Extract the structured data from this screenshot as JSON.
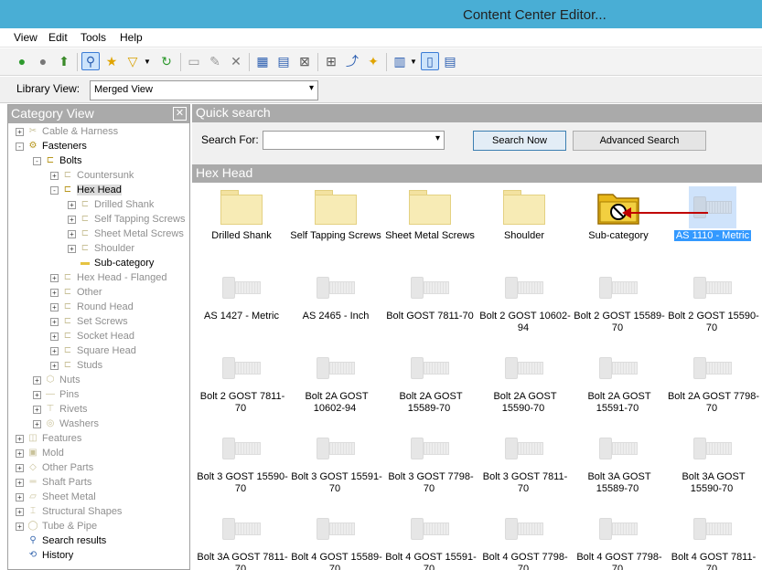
{
  "window": {
    "title": "Content Center Editor..."
  },
  "menu": [
    "View",
    "Edit",
    "Tools",
    "Help"
  ],
  "toolbar": {
    "icons": [
      "back-icon",
      "forward-icon",
      "up-folder-icon",
      "search-icon",
      "favorite-star-icon",
      "filter-icon",
      "filter-dropdown-icon",
      "refresh-icon",
      "new-folder-icon",
      "edit-folder-icon",
      "delete-folder-icon",
      "table-edit-icon",
      "family-properties-icon",
      "family-delete-icon",
      "hierarchy-icon",
      "publish-icon",
      "magic-icon",
      "view-options-icon",
      "view-dropdown-icon",
      "split-view-icon",
      "details-view-icon"
    ]
  },
  "library": {
    "label": "Library View:",
    "value": "Merged View"
  },
  "category": {
    "title": "Category View",
    "tree": [
      {
        "label": "Cable & Harness",
        "level": 0,
        "expander": "+",
        "dim": true,
        "icon": "cable-icon"
      },
      {
        "label": "Fasteners",
        "level": 0,
        "expander": "-",
        "dim": false,
        "icon": "fastener-icon"
      },
      {
        "label": "Bolts",
        "level": 1,
        "expander": "-",
        "dim": false,
        "icon": "bolt-icon"
      },
      {
        "label": "Countersunk",
        "level": 2,
        "expander": "+",
        "dim": true,
        "icon": "bolt-icon"
      },
      {
        "label": "Hex Head",
        "level": 2,
        "expander": "-",
        "dim": false,
        "icon": "bolt-icon",
        "selected": true
      },
      {
        "label": "Drilled Shank",
        "level": 3,
        "expander": "+",
        "dim": true,
        "icon": "bolt-icon"
      },
      {
        "label": "Self Tapping Screws",
        "level": 3,
        "expander": "+",
        "dim": true,
        "icon": "bolt-icon"
      },
      {
        "label": "Sheet Metal Screws",
        "level": 3,
        "expander": "+",
        "dim": true,
        "icon": "bolt-icon"
      },
      {
        "label": "Shoulder",
        "level": 3,
        "expander": "+",
        "dim": true,
        "icon": "bolt-icon"
      },
      {
        "label": "Sub-category",
        "level": 3,
        "expander": "",
        "dim": false,
        "icon": "folder-icon"
      },
      {
        "label": "Hex Head - Flanged",
        "level": 2,
        "expander": "+",
        "dim": true,
        "icon": "bolt-icon"
      },
      {
        "label": "Other",
        "level": 2,
        "expander": "+",
        "dim": true,
        "icon": "bolt-icon"
      },
      {
        "label": "Round Head",
        "level": 2,
        "expander": "+",
        "dim": true,
        "icon": "bolt-icon"
      },
      {
        "label": "Set Screws",
        "level": 2,
        "expander": "+",
        "dim": true,
        "icon": "bolt-icon"
      },
      {
        "label": "Socket Head",
        "level": 2,
        "expander": "+",
        "dim": true,
        "icon": "bolt-icon"
      },
      {
        "label": "Square Head",
        "level": 2,
        "expander": "+",
        "dim": true,
        "icon": "bolt-icon"
      },
      {
        "label": "Studs",
        "level": 2,
        "expander": "+",
        "dim": true,
        "icon": "bolt-icon"
      },
      {
        "label": "Nuts",
        "level": 1,
        "expander": "+",
        "dim": true,
        "icon": "nut-icon"
      },
      {
        "label": "Pins",
        "level": 1,
        "expander": "+",
        "dim": true,
        "icon": "pin-icon"
      },
      {
        "label": "Rivets",
        "level": 1,
        "expander": "+",
        "dim": true,
        "icon": "rivet-icon"
      },
      {
        "label": "Washers",
        "level": 1,
        "expander": "+",
        "dim": true,
        "icon": "washer-icon"
      },
      {
        "label": "Features",
        "level": 0,
        "expander": "+",
        "dim": true,
        "icon": "feature-icon"
      },
      {
        "label": "Mold",
        "level": 0,
        "expander": "+",
        "dim": true,
        "icon": "mold-icon"
      },
      {
        "label": "Other Parts",
        "level": 0,
        "expander": "+",
        "dim": true,
        "icon": "part-icon"
      },
      {
        "label": "Shaft Parts",
        "level": 0,
        "expander": "+",
        "dim": true,
        "icon": "shaft-icon"
      },
      {
        "label": "Sheet Metal",
        "level": 0,
        "expander": "+",
        "dim": true,
        "icon": "sheet-metal-icon"
      },
      {
        "label": "Structural Shapes",
        "level": 0,
        "expander": "+",
        "dim": true,
        "icon": "structural-icon"
      },
      {
        "label": "Tube & Pipe",
        "level": 0,
        "expander": "+",
        "dim": true,
        "icon": "pipe-icon"
      },
      {
        "label": "Search results",
        "level": 0,
        "expander": "",
        "dim": false,
        "icon": "search-icon"
      },
      {
        "label": "History",
        "level": 0,
        "expander": "",
        "dim": false,
        "icon": "history-icon"
      }
    ]
  },
  "quick_search": {
    "title": "Quick search",
    "search_for_label": "Search For:",
    "search_value": "",
    "search_now": "Search Now",
    "advanced_search": "Advanced Search"
  },
  "hex_head": {
    "title": "Hex Head",
    "items": [
      {
        "label": "Drilled Shank",
        "kind": "folder"
      },
      {
        "label": "Self Tapping Screws",
        "kind": "folder"
      },
      {
        "label": "Sheet Metal Screws",
        "kind": "folder"
      },
      {
        "label": "Shoulder",
        "kind": "folder"
      },
      {
        "label": "Sub-category",
        "kind": "subcat"
      },
      {
        "label": "AS 1110 - Metric",
        "kind": "bolt",
        "selected": true
      },
      {
        "label": "AS 1427 - Metric",
        "kind": "bolt"
      },
      {
        "label": "AS 2465 - Inch",
        "kind": "bolt"
      },
      {
        "label": "Bolt  GOST 7811-70",
        "kind": "bolt"
      },
      {
        "label": "Bolt 2 GOST 10602-94",
        "kind": "bolt"
      },
      {
        "label": "Bolt 2 GOST 15589-70",
        "kind": "bolt"
      },
      {
        "label": "Bolt 2 GOST 15590-70",
        "kind": "bolt"
      },
      {
        "label": "Bolt 2 GOST 7811-70",
        "kind": "bolt"
      },
      {
        "label": "Bolt 2A GOST 10602-94",
        "kind": "bolt"
      },
      {
        "label": "Bolt 2A GOST 15589-70",
        "kind": "bolt"
      },
      {
        "label": "Bolt 2A GOST 15590-70",
        "kind": "bolt"
      },
      {
        "label": "Bolt 2A GOST 15591-70",
        "kind": "bolt"
      },
      {
        "label": "Bolt 2A GOST 7798-70",
        "kind": "bolt"
      },
      {
        "label": "Bolt 3 GOST 15590-70",
        "kind": "bolt"
      },
      {
        "label": "Bolt 3 GOST 15591-70",
        "kind": "bolt"
      },
      {
        "label": "Bolt 3 GOST 7798-70",
        "kind": "bolt"
      },
      {
        "label": "Bolt 3 GOST 7811-70",
        "kind": "bolt"
      },
      {
        "label": "Bolt 3A GOST 15589-70",
        "kind": "bolt"
      },
      {
        "label": "Bolt 3A GOST 15590-70",
        "kind": "bolt"
      },
      {
        "label": "Bolt 3A GOST 7811-70",
        "kind": "bolt"
      },
      {
        "label": "Bolt 4 GOST 15589-70",
        "kind": "bolt"
      },
      {
        "label": "Bolt 4 GOST 15591-70",
        "kind": "bolt"
      },
      {
        "label": "Bolt 4 GOST 7798-70",
        "kind": "bolt"
      },
      {
        "label": "Bolt 4 GOST 7798-70",
        "kind": "bolt"
      },
      {
        "label": "Bolt 4 GOST 7811-70",
        "kind": "bolt"
      }
    ]
  },
  "colors": {
    "titlebar": "#49aed5",
    "header": "#aaaaaa",
    "selection": "#3399ff",
    "arrow": "#c00000"
  }
}
